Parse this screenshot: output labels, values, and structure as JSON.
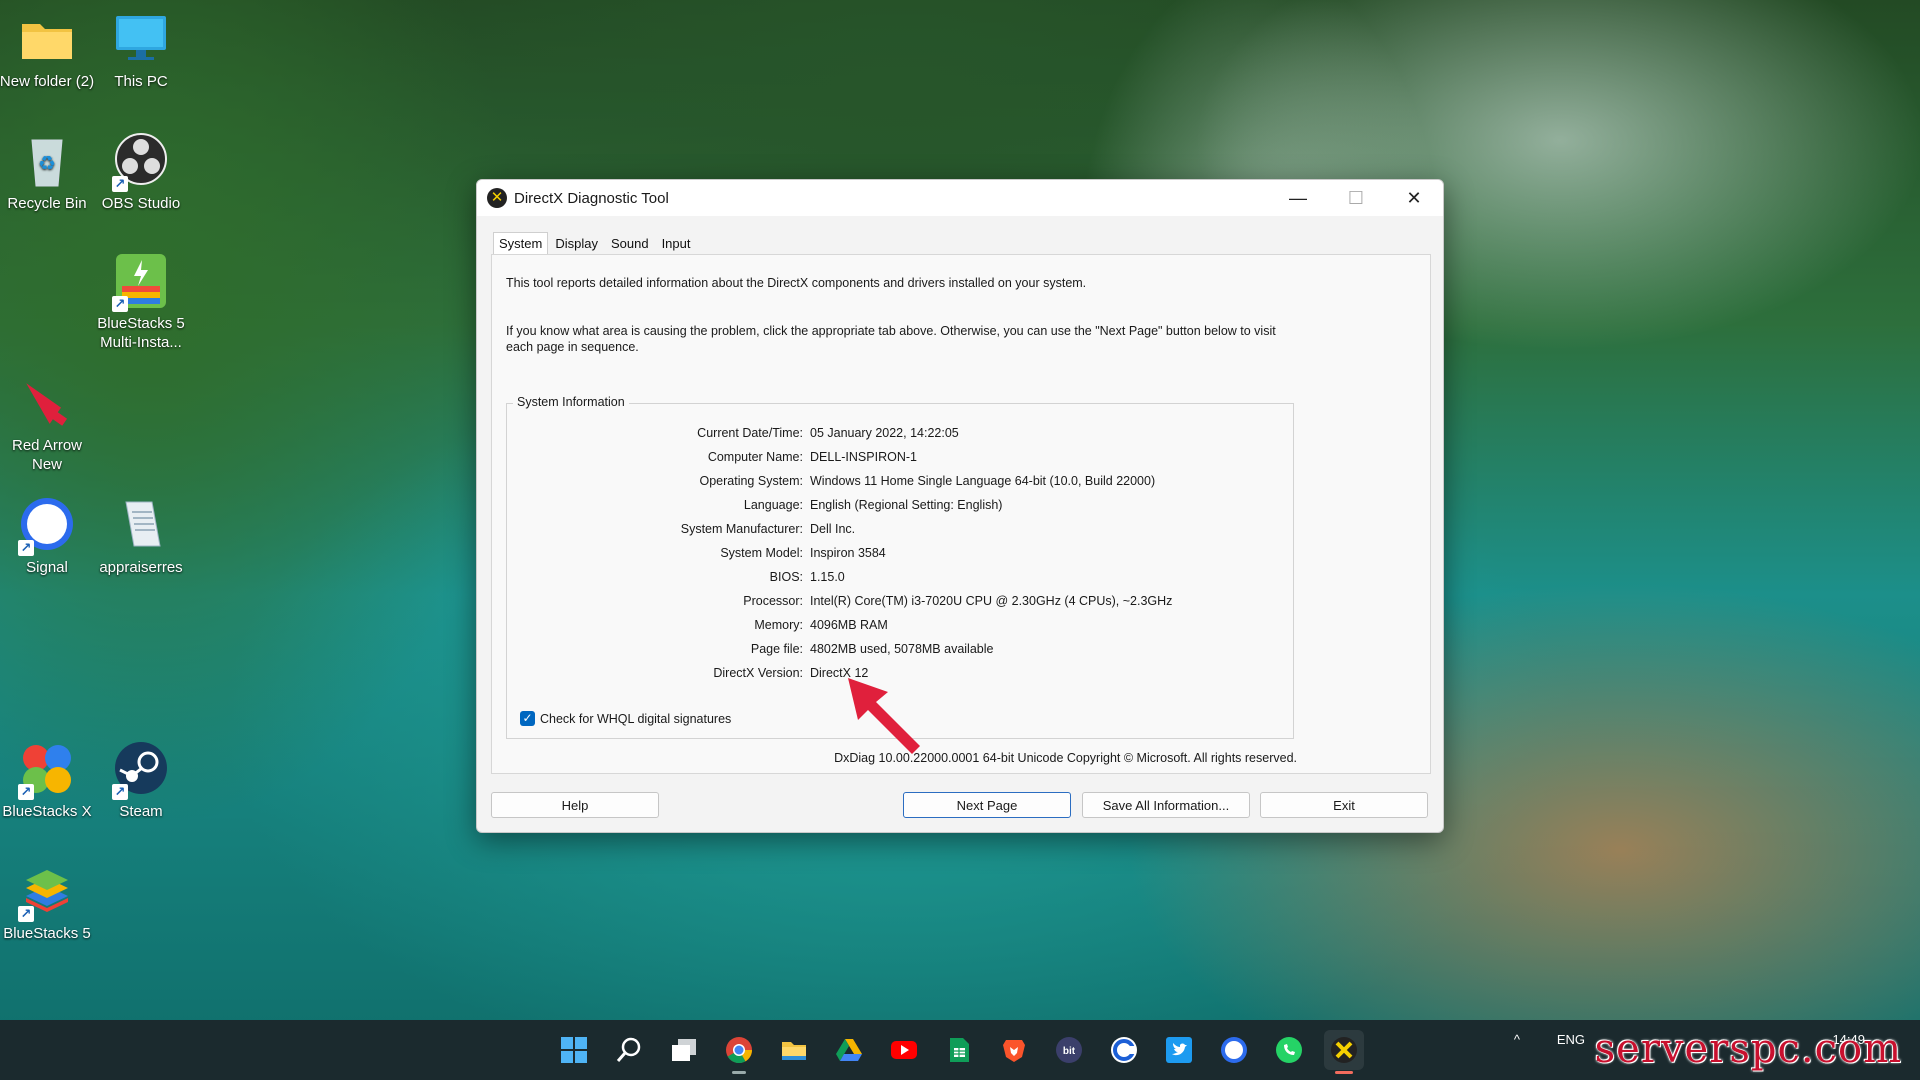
{
  "desktop": {
    "icons": [
      {
        "label": "New folder (2)",
        "icon": "folder-icon"
      },
      {
        "label": "This PC",
        "icon": "monitor-icon"
      },
      {
        "label": "Recycle Bin",
        "icon": "recycle-bin-icon"
      },
      {
        "label": "OBS Studio",
        "icon": "obs-icon"
      },
      {
        "label": "BlueStacks 5 Multi-Insta...",
        "icon": "bluestacks-multi-icon"
      },
      {
        "label": "Red Arrow New",
        "icon": "red-arrow-icon"
      },
      {
        "label": "Signal",
        "icon": "signal-icon"
      },
      {
        "label": "appraiserres",
        "icon": "notepad-icon"
      },
      {
        "label": "BlueStacks X",
        "icon": "bluestacks-x-icon"
      },
      {
        "label": "Steam",
        "icon": "steam-icon"
      },
      {
        "label": "BlueStacks 5",
        "icon": "bluestacks-icon"
      }
    ]
  },
  "window": {
    "title": "DirectX Diagnostic Tool",
    "tabs": [
      {
        "label": "System",
        "active": true
      },
      {
        "label": "Display",
        "active": false
      },
      {
        "label": "Sound",
        "active": false
      },
      {
        "label": "Input",
        "active": false
      }
    ],
    "intro1": "This tool reports detailed information about the DirectX components and drivers installed on your system.",
    "intro2": "If you know what area is causing the problem, click the appropriate tab above.  Otherwise, you can use the \"Next Page\" button below to visit each page in sequence.",
    "system_info": {
      "legend": "System Information",
      "rows": [
        {
          "label": "Current Date/Time:",
          "value": "05 January 2022, 14:22:05"
        },
        {
          "label": "Computer Name:",
          "value": "DELL-INSPIRON-1"
        },
        {
          "label": "Operating System:",
          "value": "Windows 11 Home Single Language 64-bit (10.0, Build 22000)"
        },
        {
          "label": "Language:",
          "value": "English (Regional Setting: English)"
        },
        {
          "label": "System Manufacturer:",
          "value": "Dell Inc."
        },
        {
          "label": "System Model:",
          "value": "Inspiron 3584"
        },
        {
          "label": "BIOS:",
          "value": "1.15.0"
        },
        {
          "label": "Processor:",
          "value": "Intel(R) Core(TM) i3-7020U CPU @ 2.30GHz (4 CPUs), ~2.3GHz"
        },
        {
          "label": "Memory:",
          "value": "4096MB RAM"
        },
        {
          "label": "Page file:",
          "value": "4802MB used, 5078MB available"
        },
        {
          "label": "DirectX Version:",
          "value": "DirectX 12"
        }
      ]
    },
    "whql_label": "Check for WHQL digital signatures",
    "whql_checked": true,
    "copyright": "DxDiag 10.00.22000.0001 64-bit Unicode  Copyright © Microsoft. All rights reserved.",
    "buttons": {
      "help": "Help",
      "next_page": "Next Page",
      "save_all": "Save All Information...",
      "exit": "Exit"
    }
  },
  "taskbar": {
    "apps": [
      "start-icon",
      "search-icon",
      "task-view-icon",
      "chrome-icon",
      "file-explorer-icon",
      "google-drive-icon",
      "youtube-icon",
      "google-sheets-icon",
      "brave-icon",
      "bit-icon",
      "ccleaner-icon",
      "twitter-icon",
      "signal-icon",
      "whatsapp-icon",
      "dxdiag-icon"
    ],
    "tray": {
      "language": "ENG",
      "time": "14:49"
    }
  },
  "watermark": "serverspc.com",
  "colors": {
    "accent": "#0067c0",
    "annotation": "#e0203c",
    "watermark": "#c8102e"
  }
}
